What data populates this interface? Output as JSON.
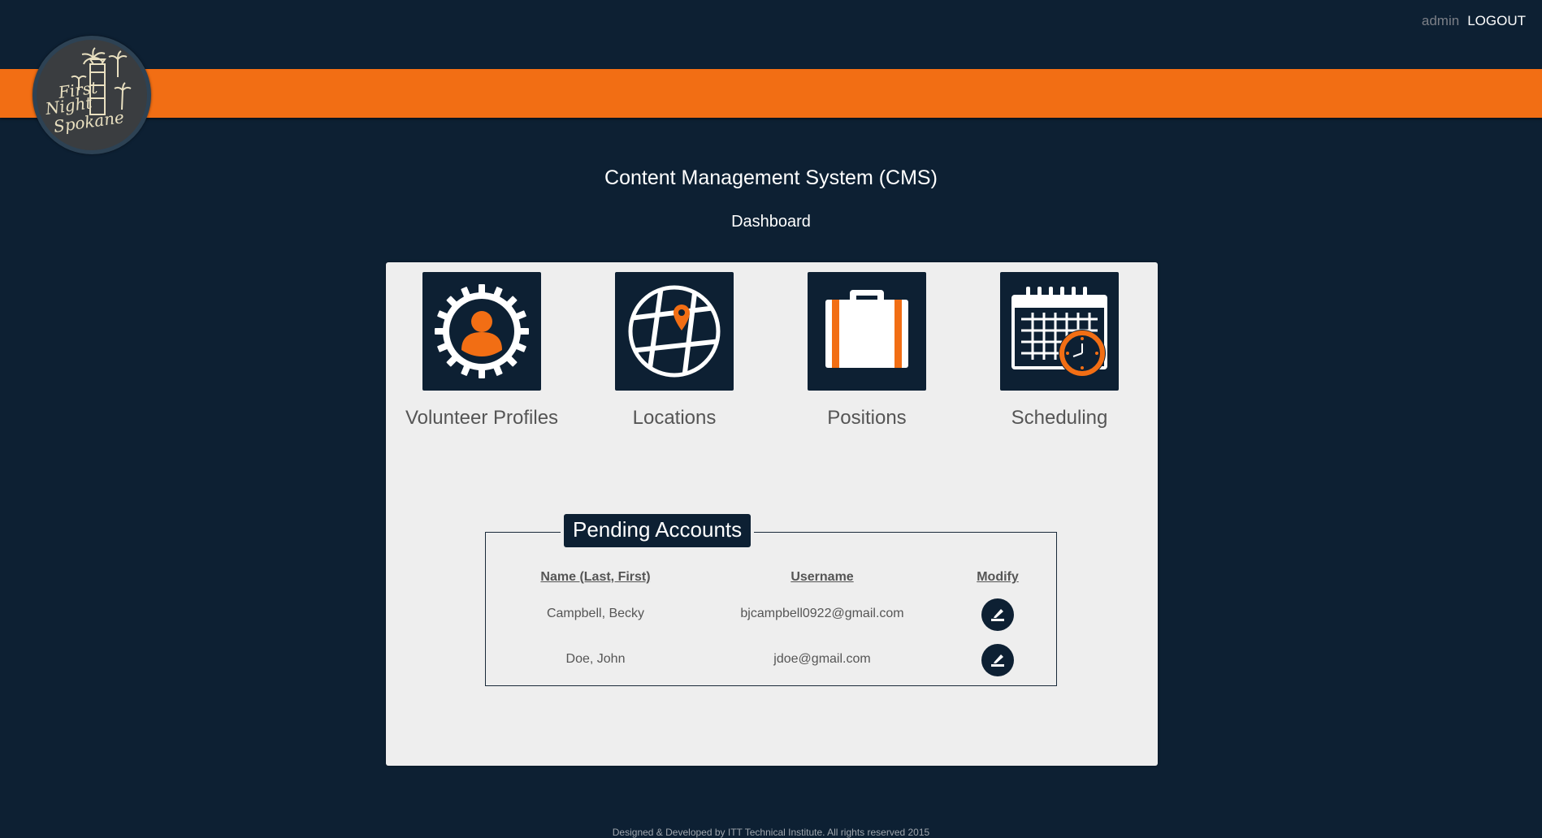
{
  "header": {
    "user": "admin",
    "logout_label": "LOGOUT",
    "logo_text": [
      "First",
      "Night",
      "Spokane"
    ]
  },
  "page": {
    "title": "Content Management System (CMS)",
    "subtitle": "Dashboard"
  },
  "tiles": [
    {
      "label": "Volunteer Profiles",
      "icon": "volunteer-gear-icon"
    },
    {
      "label": "Locations",
      "icon": "map-pin-icon"
    },
    {
      "label": "Positions",
      "icon": "briefcase-icon"
    },
    {
      "label": "Scheduling",
      "icon": "calendar-clock-icon"
    }
  ],
  "pending": {
    "title": "Pending Accounts",
    "columns": [
      "Name (Last, First)",
      "Username",
      "Modify"
    ],
    "rows": [
      {
        "name": "Campbell, Becky",
        "username": "bjcampbell0922@gmail.com",
        "modify_icon": "edit-icon"
      },
      {
        "name": "Doe, John",
        "username": "jdoe@gmail.com",
        "modify_icon": "edit-icon"
      }
    ]
  },
  "footer": {
    "text": "Designed & Developed by ITT Technical Institute. All rights reserved 2015"
  },
  "colors": {
    "background": "#0d2033",
    "accent": "#f26e14",
    "panel": "#eeeeee"
  }
}
